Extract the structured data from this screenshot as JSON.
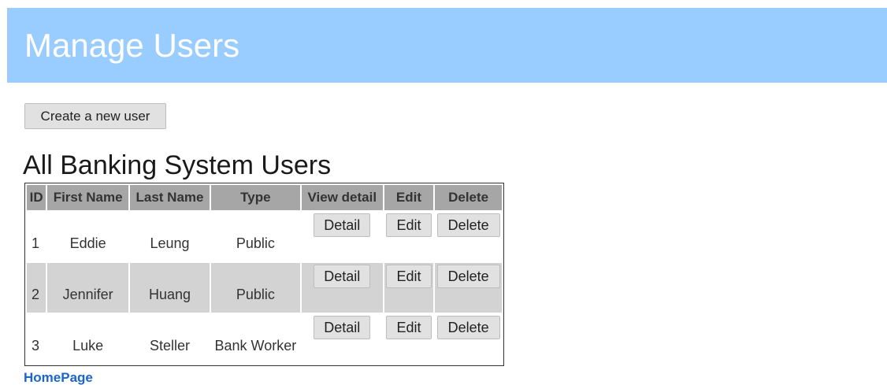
{
  "header": {
    "title": "Manage Users"
  },
  "toolbar": {
    "create_label": "Create a new user"
  },
  "section": {
    "title": "All Banking System Users"
  },
  "table": {
    "columns": [
      "ID",
      "First Name",
      "Last Name",
      "Type",
      "View detail",
      "Edit",
      "Delete"
    ],
    "rows": [
      {
        "id": "1",
        "first_name": "Eddie",
        "last_name": "Leung",
        "type": "Public",
        "detail_label": "Detail",
        "edit_label": "Edit",
        "delete_label": "Delete"
      },
      {
        "id": "2",
        "first_name": "Jennifer",
        "last_name": "Huang",
        "type": "Public",
        "detail_label": "Detail",
        "edit_label": "Edit",
        "delete_label": "Delete"
      },
      {
        "id": "3",
        "first_name": "Luke",
        "last_name": "Steller",
        "type": "Bank Worker",
        "detail_label": "Detail",
        "edit_label": "Edit",
        "delete_label": "Delete"
      }
    ]
  },
  "footer": {
    "home_link": "HomePage"
  },
  "colors": {
    "header_bg": "#99ccff",
    "header_text": "#ffffff",
    "table_header_bg": "#a6a6a6",
    "alt_row_bg": "#d3d3d3",
    "link": "#1a66cc"
  }
}
